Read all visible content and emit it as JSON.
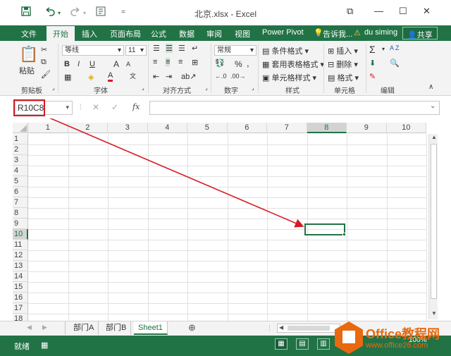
{
  "window": {
    "title": "北京.xlsx - Excel",
    "save_icon": "save-icon",
    "undo_icon": "undo-icon",
    "redo_icon": "redo-icon",
    "help_glyph": "?",
    "restore_glyph": "⧉",
    "minimize_glyph": "—",
    "maximize_glyph": "☐",
    "close_glyph": "✕"
  },
  "tabs": [
    {
      "label": "文件"
    },
    {
      "label": "开始"
    },
    {
      "label": "插入"
    },
    {
      "label": "页面布局"
    },
    {
      "label": "公式"
    },
    {
      "label": "数据"
    },
    {
      "label": "审阅"
    },
    {
      "label": "视图"
    },
    {
      "label": "Power Pivot"
    },
    {
      "label": "告诉我..."
    },
    {
      "label": "du siming"
    },
    {
      "label": "共享"
    }
  ],
  "ribbon": {
    "clipboard": {
      "paste": "粘贴",
      "group": "剪贴板"
    },
    "font": {
      "name": "等线",
      "size": "11",
      "bold": "B",
      "italic": "I",
      "underline": "U",
      "grow": "A",
      "shrink": "A",
      "fontcolor": "A",
      "group": "字体"
    },
    "alignment": {
      "group": "对齐方式"
    },
    "number": {
      "format": "常规",
      "percent": "%",
      "comma": ",",
      "group": "数字"
    },
    "styles": {
      "conditional": "条件格式",
      "table": "套用表格格式",
      "cell": "单元格样式",
      "group": "样式"
    },
    "cells": {
      "insert": "插入",
      "delete": "删除",
      "format": "格式",
      "group": "单元格"
    },
    "editing": {
      "sum": "Σ",
      "sort": "A Z",
      "group": "编辑"
    }
  },
  "formula_bar": {
    "name_box": "R10C8",
    "cancel": "✕",
    "enter": "✓",
    "fx": "fx",
    "value": ""
  },
  "grid": {
    "columns": [
      "1",
      "2",
      "3",
      "4",
      "5",
      "6",
      "7",
      "8",
      "9",
      "10"
    ],
    "rows": [
      "1",
      "2",
      "3",
      "4",
      "5",
      "6",
      "7",
      "8",
      "9",
      "10",
      "11",
      "12",
      "13",
      "14",
      "15",
      "16",
      "17",
      "18"
    ],
    "selected_column": "8",
    "selected_row": "10"
  },
  "sheets": {
    "tabs": [
      "部门A",
      "部门B",
      "Sheet1"
    ],
    "active": "Sheet1",
    "add": "⊕"
  },
  "status": {
    "ready": "就绪",
    "zoom": "100%"
  },
  "watermark": {
    "brand": "Office教程网",
    "url": "www.office26.com"
  },
  "colors": {
    "accent": "#217346",
    "highlight": "#d61b23",
    "watermark": "#e8690f"
  }
}
